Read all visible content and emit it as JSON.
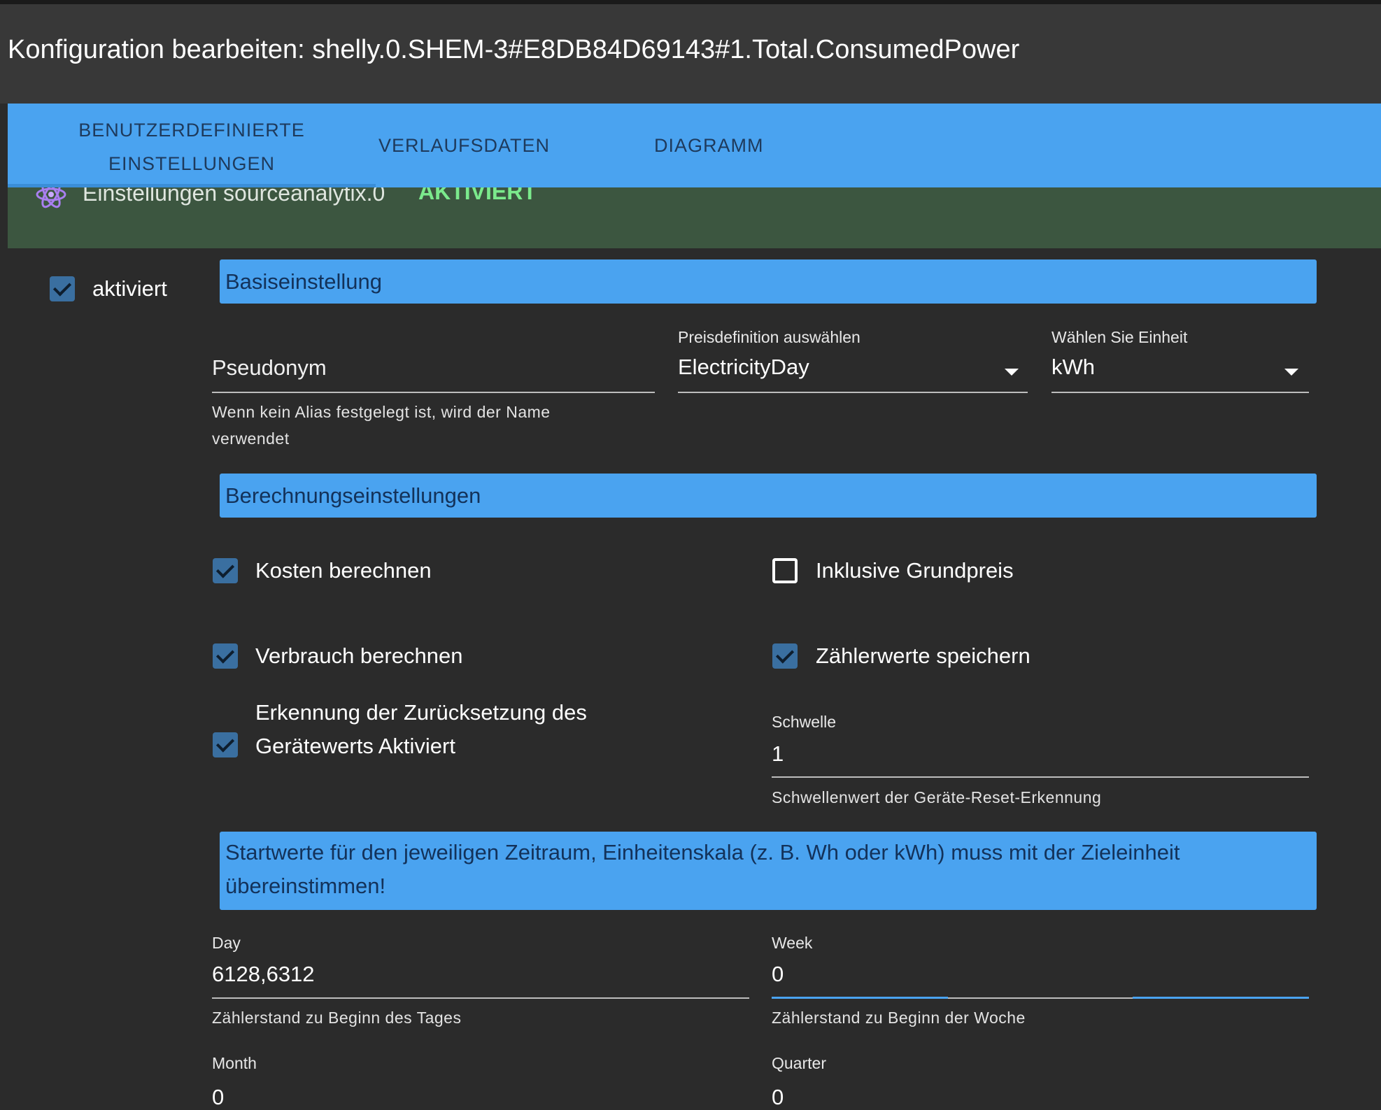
{
  "dialog": {
    "title": "Konfiguration bearbeiten: shelly.0.SHEM-3#E8DB84D69143#1.Total.ConsumedPower"
  },
  "tabs": [
    {
      "label_line1": "BENUTZERDEFINIERTE",
      "label_line2": "EINSTELLUNGEN",
      "active": true
    },
    {
      "label": "VERLAUFSDATEN"
    },
    {
      "label": "DIAGRAMM"
    }
  ],
  "adapter": {
    "title": "Einstellungen sourceanalytix.0",
    "status": "AKTIVIERT",
    "icon": "atom-icon"
  },
  "enabled": {
    "label": "aktiviert",
    "checked": true
  },
  "basic": {
    "header": "Basiseinstellung",
    "alias": {
      "placeholder": "Pseudonym",
      "helper": "Wenn kein Alias festgelegt ist, wird der Name verwendet"
    },
    "price": {
      "label": "Preisdefinition auswählen",
      "value": "ElectricityDay"
    },
    "unit": {
      "label": "Wählen Sie Einheit",
      "value": "kWh"
    }
  },
  "calc": {
    "header": "Berechnungseinstellungen",
    "cost": {
      "label": "Kosten berechnen",
      "checked": true
    },
    "base_price": {
      "label": "Inklusive Grundpreis",
      "checked": false
    },
    "consumption": {
      "label": "Verbrauch berechnen",
      "checked": true
    },
    "meter_values": {
      "label": "Zählerwerte speichern",
      "checked": true
    },
    "reset": {
      "label_line1": "Erkennung der Zurücksetzung des",
      "label_line2": "Gerätewerts Aktiviert",
      "checked": true
    },
    "threshold": {
      "label": "Schwelle",
      "value": "1",
      "helper": "Schwellenwert der Geräte-Reset-Erkennung"
    }
  },
  "start": {
    "header_line1": "Startwerte für den jeweiligen Zeitraum, Einheitenskala (z. B. Wh oder kWh) muss mit der Zieleinheit",
    "header_line2": "übereinstimmen!",
    "day": {
      "label": "Day",
      "value": "6128,6312",
      "helper": "Zählerstand zu Beginn des Tages"
    },
    "week": {
      "label": "Week",
      "value": "0",
      "helper": "Zählerstand zu Beginn der Woche"
    },
    "month": {
      "label": "Month",
      "value": "0"
    },
    "quarter": {
      "label": "Quarter",
      "value": "0"
    }
  },
  "colors": {
    "accent": "#4aa3f0",
    "success": "#7bea8c",
    "checkbox": "#3a6fa0"
  }
}
